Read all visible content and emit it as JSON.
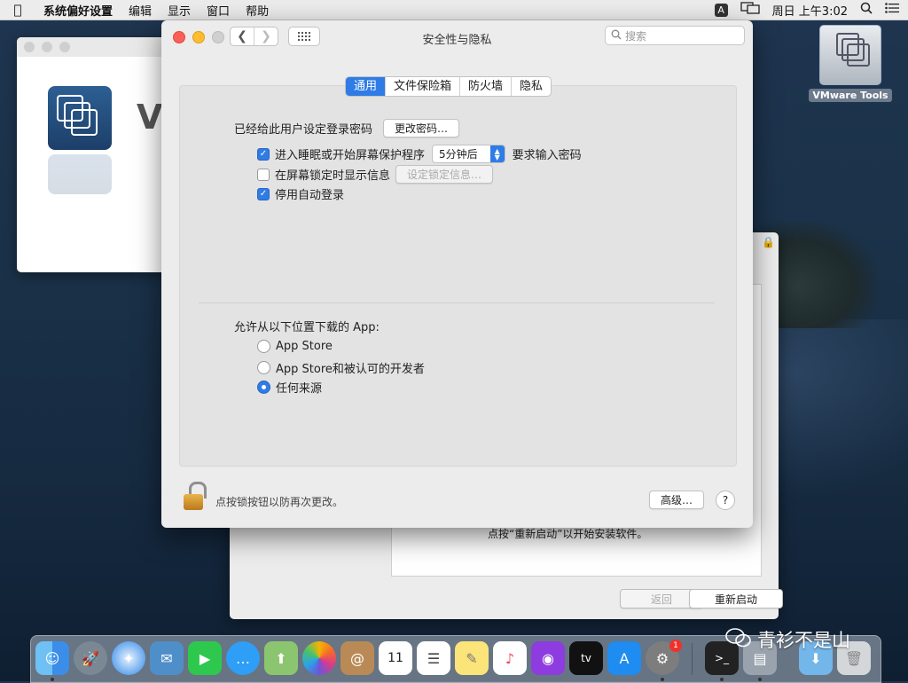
{
  "menubar": {
    "app_name": "系统偏好设置",
    "items": [
      "编辑",
      "显示",
      "窗口",
      "帮助"
    ],
    "input_indicator": "A",
    "clock": "周日 上午3:02"
  },
  "background_window": {
    "message": "点按“重新启动”以开始安装软件。",
    "back_label": "返回",
    "restart_label": "重新启动",
    "partial_title": "V"
  },
  "window": {
    "title": "安全性与隐私",
    "search_placeholder": "搜索"
  },
  "tabs": [
    {
      "label": "通用",
      "active": true
    },
    {
      "label": "文件保险箱",
      "active": false
    },
    {
      "label": "防火墙",
      "active": false
    },
    {
      "label": "隐私",
      "active": false
    }
  ],
  "general": {
    "password_label": "已经给此用户设定登录密码",
    "change_password_button": "更改密码…",
    "sleep_checkbox_label": "进入睡眠或开始屏幕保护程序",
    "sleep_checked": true,
    "delay_value": "5分钟后",
    "require_password_label": "要求输入密码",
    "lock_message_label": "在屏幕锁定时显示信息",
    "lock_message_checked": false,
    "set_lock_message_button": "设定锁定信息…",
    "disable_autologin_label": "停用自动登录",
    "disable_autologin_checked": true,
    "download_label": "允许从以下位置下载的 App:",
    "download_options": [
      {
        "label": "App Store",
        "selected": false
      },
      {
        "label": "App Store和被认可的开发者",
        "selected": false
      },
      {
        "label": "任何来源",
        "selected": true
      }
    ]
  },
  "footer": {
    "lock_text": "点按锁按钮以防再次更改。",
    "advanced_button": "高级…",
    "help_button": "?"
  },
  "desktop": {
    "vmware_tools_label": "VMware Tools"
  },
  "dock": {
    "badge_count": "1",
    "tv_label": "tv"
  },
  "watermark": "青衫不是山",
  "colors": {
    "accent": "#2f7ce6",
    "close": "#fc5f57",
    "minimize": "#fdbd2e"
  }
}
